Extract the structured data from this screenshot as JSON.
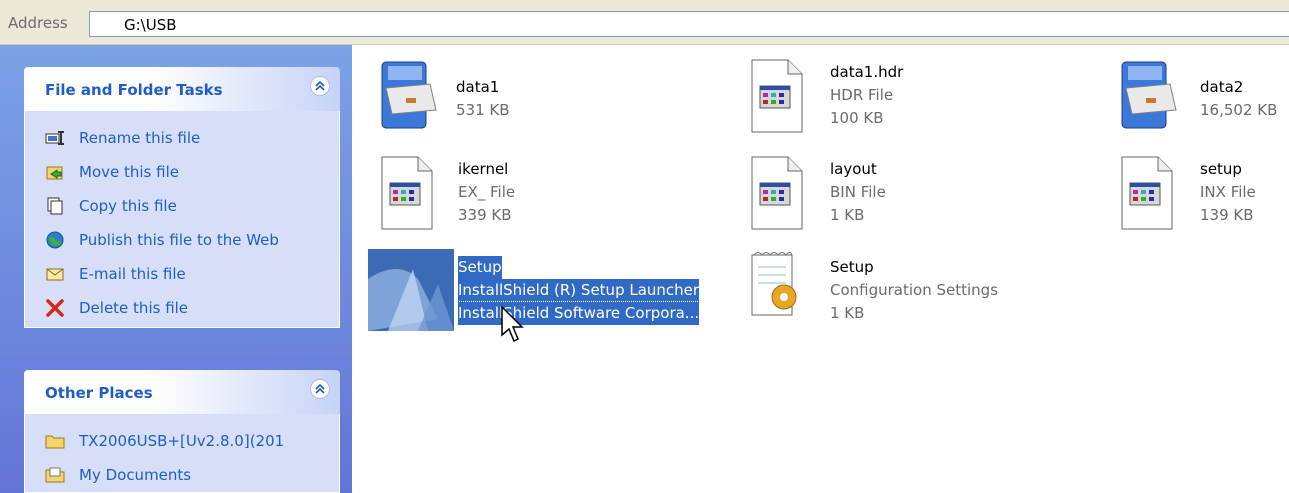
{
  "address": {
    "label": "Address",
    "value": "G:\\USB"
  },
  "file_tasks": {
    "title": "File and Folder Tasks",
    "items": [
      {
        "label": "Rename this file",
        "icon": "rename-icon"
      },
      {
        "label": "Move this file",
        "icon": "move-icon"
      },
      {
        "label": "Copy this file",
        "icon": "copy-icon"
      },
      {
        "label": "Publish this file to the Web",
        "icon": "publish-web-icon"
      },
      {
        "label": "E-mail this file",
        "icon": "email-icon"
      },
      {
        "label": "Delete this file",
        "icon": "delete-icon"
      }
    ]
  },
  "other_places": {
    "title": "Other Places",
    "items": [
      {
        "label": "TX2006USB+[Uv2.8.0](201",
        "icon": "folder-icon"
      },
      {
        "label": "My Documents",
        "icon": "my-documents-icon"
      }
    ]
  },
  "files": [
    {
      "name": "data1",
      "line2": "531 KB",
      "line3": "",
      "icon": "cabinet-icon"
    },
    {
      "name": "data1.hdr",
      "line2": "HDR File",
      "line3": "100 KB",
      "icon": "generic-file-icon"
    },
    {
      "name": "data2",
      "line2": "16,502 KB",
      "line3": "",
      "icon": "cabinet-icon"
    },
    {
      "name": "ikernel",
      "line2": "EX_ File",
      "line3": "339 KB",
      "icon": "generic-file-icon"
    },
    {
      "name": "layout",
      "line2": "BIN File",
      "line3": "1 KB",
      "icon": "generic-file-icon"
    },
    {
      "name": "setup",
      "line2": "INX File",
      "line3": "139 KB",
      "icon": "generic-file-icon"
    },
    {
      "name": "Setup",
      "line2": "InstallShield (R) Setup Launcher",
      "line3": "InstallShield Software Corpora...",
      "icon": "installshield-icon",
      "selected": true
    },
    {
      "name": "Setup",
      "line2": "Configuration Settings",
      "line3": "1 KB",
      "icon": "config-settings-icon"
    }
  ]
}
